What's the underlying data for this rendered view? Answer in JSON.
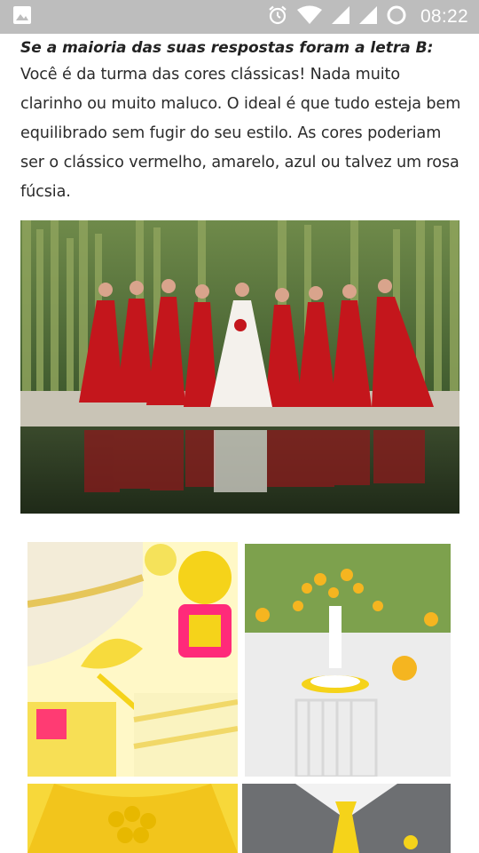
{
  "status_bar": {
    "time": "08:22",
    "icons": [
      "image-notification-icon",
      "alarm-icon",
      "wifi-icon",
      "cell-signal-icon",
      "cell-signal-2-icon",
      "battery-ring-icon"
    ]
  },
  "article": {
    "lead": "Se a maioria das suas respostas foram a letra B:",
    "body": "Você é da turma das cores clássicas! Nada muito clarinho ou muito maluco. O ideal é que tudo esteja bem equilibrado sem fugir do seu estilo. As cores poderiam ser o clássico vermelho, amarelo, azul ou talvez um rosa fúcsia."
  },
  "images": {
    "bridal_party": {
      "description_icon": "photo-bridal-party"
    },
    "collage": {
      "logo_text": ""
    }
  },
  "colors": {
    "status_bar": "#bdbdbd",
    "dress_red": "#c4161c",
    "yellow": "#f5d31a",
    "text": "#2b2b2b"
  }
}
